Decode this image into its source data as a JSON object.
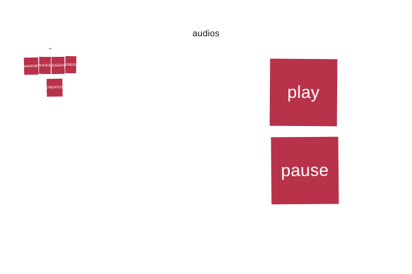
{
  "page": {
    "title": "audios",
    "small_label": "aa"
  },
  "nav": {
    "items": [
      {
        "label": "IMAGENES"
      },
      {
        "label": "AUDIOS"
      },
      {
        "label": "JUEGOS"
      },
      {
        "label": "VIDEOS"
      },
      {
        "label": "CREDITOS"
      }
    ]
  },
  "controls": {
    "play_label": "play",
    "pause_label": "pause"
  },
  "colors": {
    "tile_background": "#b8324a",
    "tile_text": "#ffffff",
    "page_background": "#ffffff"
  }
}
